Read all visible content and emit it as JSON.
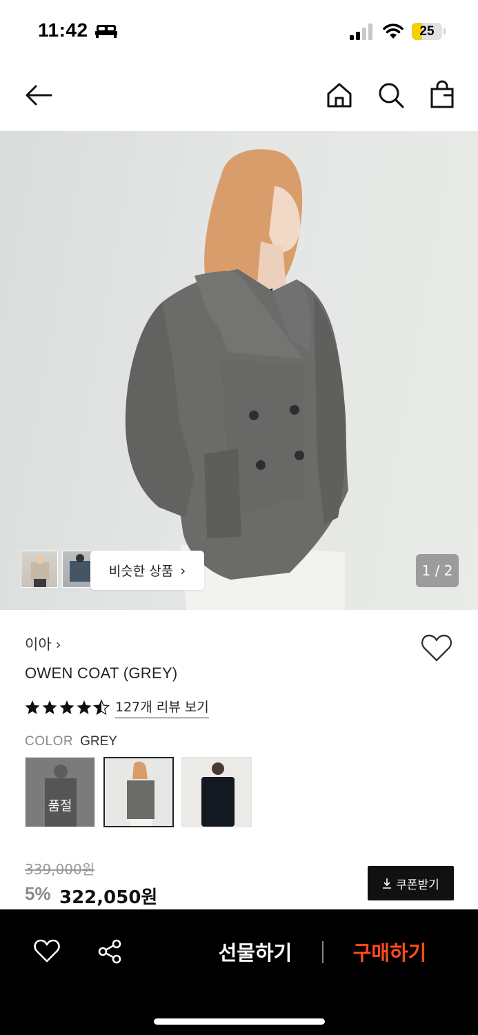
{
  "status_bar": {
    "time": "11:42",
    "battery": "25",
    "battery_level": 0.25,
    "icons": [
      "bed-icon",
      "signal-icon",
      "wifi-icon",
      "battery-icon"
    ]
  },
  "header": {
    "icons": [
      "back-arrow-icon",
      "home-icon",
      "search-icon",
      "shopping-bag-icon"
    ]
  },
  "gallery": {
    "similar_label": "비슷한 상품",
    "pager": "1 / 2"
  },
  "product": {
    "brand": "이아",
    "name": "OWEN COAT (GREY)",
    "rating": 4.5,
    "review_link": "127개 리뷰 보기",
    "color_label": "COLOR",
    "color_value": "GREY",
    "swatches": [
      {
        "status": "품절",
        "selected": false
      },
      {
        "selected": true
      },
      {
        "selected": false
      }
    ],
    "original_price": "339,000원",
    "discount": "5%",
    "sale_price": "322,050원",
    "coupon_label": "쿠폰받기"
  },
  "bottom_bar": {
    "gift_label": "선물하기",
    "buy_label": "구매하기",
    "colors": {
      "buy": "#ff4b1f",
      "background": "#000000"
    }
  }
}
